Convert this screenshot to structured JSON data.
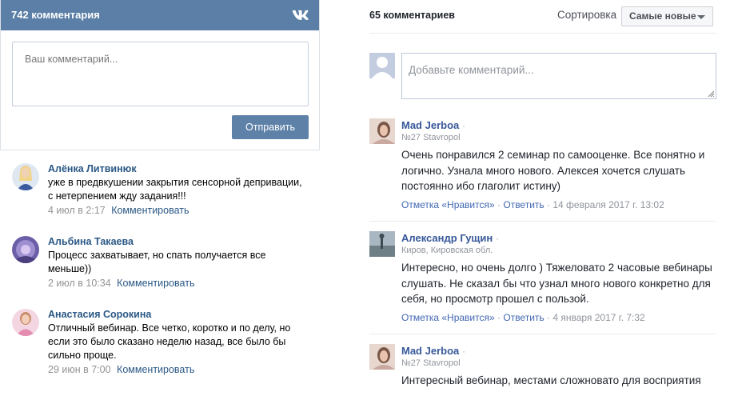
{
  "vk": {
    "header_title": "742 комментария",
    "logo_icon": "vk-logo-icon",
    "comment_placeholder": "Ваш комментарий...",
    "send_label": "Отправить",
    "comments": [
      {
        "name": "Алёнка Литвинюк",
        "text": "уже в предвкушении закрытия сенсорной депривации, с нетерпением жду задания!!!",
        "date": "4 июл в 2:17",
        "reply": "Комментировать"
      },
      {
        "name": "Альбина Такаева",
        "text": "Процесс захватывает, но спать получается все меньше))",
        "date": "2 июл в 10:34",
        "reply": "Комментировать"
      },
      {
        "name": "Анастасия Сорокина",
        "text": "Отличный вебинар. Все четко, коротко и по делу, но если это было сказано неделю назад, все было бы сильно проще.",
        "date": "29 июн в 7:00",
        "reply": "Комментировать"
      }
    ]
  },
  "fb": {
    "count_label": "65 комментариев",
    "sort_label": "Сортировка",
    "sort_value": "Самые новые",
    "comment_placeholder": "Добавьте комментарий...",
    "comments": [
      {
        "name": "Mad Jerboa",
        "dot": "·",
        "sub": "№27 Stavropol",
        "text": "Очень понравился 2 семинар по самооценке. Все понятно и логично. Узнала много нового. Алексея хочется слушать постоянно ибо глаголит истину)",
        "like": "Отметка «Нравится»",
        "sep": "·",
        "reply": "Ответить",
        "date": "14 февраля 2017 г. 13:02"
      },
      {
        "name": "Александр Гущин",
        "dot": "·",
        "sub": "Киров, Кировская обл.",
        "text": "Интересно, но очень долго ) Тяжеловато 2 часовые вебинары слушать. Не сказал бы что узнал много нового конкретно для себя, но просмотр прошел с пользой.",
        "like": "Отметка «Нравится»",
        "sep": "·",
        "reply": "Ответить",
        "date": "4 января 2017 г. 7:32"
      },
      {
        "name": "Mad Jerboa",
        "dot": "·",
        "sub": "№27 Stavropol",
        "text": "Интересный вебинар, местами сложновато для восприятия"
      }
    ]
  },
  "colors": {
    "vk_header": "#5b7fa6",
    "vk_link": "#2a5885",
    "fb_name": "#365899",
    "fb_link": "#4267b2",
    "muted": "#90949c"
  }
}
